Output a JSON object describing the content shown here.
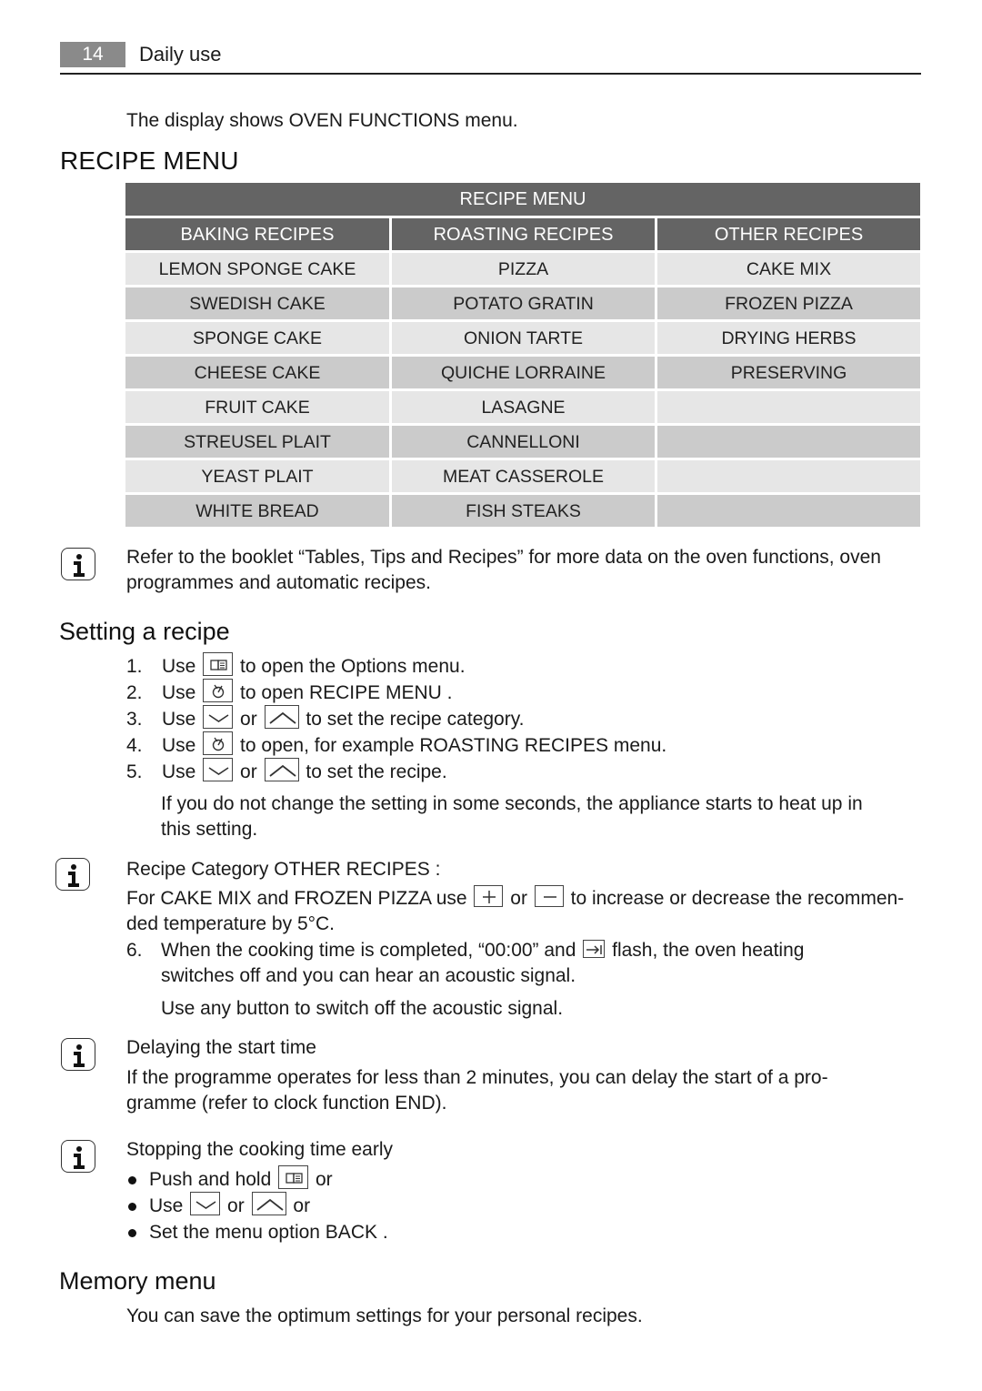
{
  "header": {
    "page_number": "14",
    "section": "Daily use"
  },
  "intro_text": "The display shows OVEN FUNCTIONS menu.",
  "recipe_menu_heading": "RECIPE MENU",
  "table": {
    "title": "RECIPE MENU",
    "columns": [
      "BAKING RECIPES",
      "ROASTING RECIPES",
      "OTHER RECIPES"
    ],
    "rows": [
      [
        "LEMON SPONGE CAKE",
        "PIZZA",
        "CAKE MIX"
      ],
      [
        "SWEDISH CAKE",
        "POTATO GRATIN",
        "FROZEN PIZZA"
      ],
      [
        "SPONGE CAKE",
        "ONION TARTE",
        "DRYING HERBS"
      ],
      [
        "CHEESE CAKE",
        "QUICHE LORRAINE",
        "PRESERVING"
      ],
      [
        "FRUIT CAKE",
        "LASAGNE",
        ""
      ],
      [
        "STREUSEL PLAIT",
        "CANNELLONI",
        ""
      ],
      [
        "YEAST PLAIT",
        "MEAT CASSEROLE",
        ""
      ],
      [
        "WHITE BREAD",
        "FISH STEAKS",
        ""
      ]
    ]
  },
  "note_booklet": {
    "line1": "Refer to the booklet “Tables, Tips and Recipes” for more data on the oven functions, oven",
    "line2": "programmes and automatic recipes."
  },
  "setting_recipe": {
    "heading": "Setting a recipe",
    "steps": [
      {
        "num": "1.",
        "pre": "Use",
        "icons": [
          "options-book-icon"
        ],
        "post": "to open the Options menu."
      },
      {
        "num": "2.",
        "pre": "Use",
        "icons": [
          "recipe-clock-icon"
        ],
        "post": "to open RECIPE MENU ."
      },
      {
        "num": "3.",
        "pre": "Use",
        "mid": "or",
        "icons": [
          "arrow-down-icon",
          "arrow-up-icon"
        ],
        "post": "to set the recipe category."
      },
      {
        "num": "4.",
        "pre": "Use",
        "icons": [
          "recipe-clock-icon"
        ],
        "post": "to open, for example ROASTING RECIPES menu."
      },
      {
        "num": "5.",
        "pre": "Use",
        "mid": "or",
        "icons": [
          "arrow-down-icon",
          "arrow-up-icon"
        ],
        "post": "to set the recipe."
      }
    ],
    "step5_note": {
      "line1": "If you do not change the setting in some seconds, the appliance starts to heat up in",
      "line2": "this setting."
    }
  },
  "note_other_recipes": {
    "title": "Recipe Category OTHER RECIPES :",
    "line1_pre": "For CAKE MIX and FROZEN PIZZA use",
    "line1_mid": "or",
    "line1_post": "to increase or decrease the recommen-",
    "line2": "ded temperature by 5°C."
  },
  "step6": {
    "num": "6.",
    "line1_pre": "When the cooking time is completed, “00:00” and",
    "line1_post": "flash, the oven heating",
    "line2": "switches off and you can hear an acoustic signal.",
    "note": "Use any button to switch off the acoustic signal."
  },
  "note_delay": {
    "title": "Delaying the start time",
    "line1": "If the programme operates for less than 2 minutes, you can delay the start of a pro-",
    "line2": "gramme (refer to clock function END)."
  },
  "note_stop": {
    "title": "Stopping the cooking time early",
    "bullets": [
      {
        "pre": "Push and hold",
        "post": "or"
      },
      {
        "pre": "Use",
        "mid": "or",
        "post": "or"
      },
      {
        "text": "Set the menu option BACK ."
      }
    ]
  },
  "memory_menu": {
    "heading": "Memory menu",
    "text": "You can save the optimum settings for your personal recipes."
  },
  "colors": {
    "table_header": "#646464",
    "row_light": "#e6e6e6",
    "row_dark": "#cbcbcb",
    "page_tab": "#8a8a8a"
  }
}
